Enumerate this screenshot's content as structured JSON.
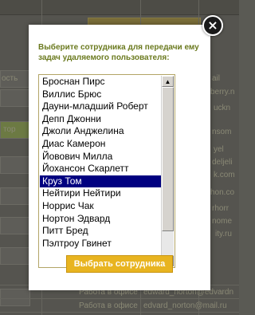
{
  "background": {
    "left_labels": [
      "ость",
      "тор"
    ],
    "right_labels": [
      "ail",
      "berry.n",
      "uckn",
      "nsom",
      "yel",
      "deljeli",
      "k.com",
      "hon.co",
      "rhorr",
      "nome",
      "ity.ru"
    ],
    "bottom_rows": [
      {
        "status": "Работа в офисе",
        "email": "edward_norton@edvardn"
      },
      {
        "status": "Работа в офисе",
        "email": "edvard_norton@mail.ru"
      }
    ]
  },
  "dialog": {
    "prompt": "Выберите сотрудника для передачи ему задач удаляемого пользователя:",
    "close_label": "×",
    "select_button_label": "Выбрать сотрудника",
    "selected_index": 8,
    "employees": [
      "Броснан Пирс",
      "Виллис Брюс",
      "Дауни-младший Роберт",
      "Депп Джонни",
      "Джоли Анджелина",
      "Диас Камерон",
      "Йовович Милла",
      "Йохансон Скарлетт",
      "Круз Том",
      "Нейтири Нейтири",
      "Норрис Чак",
      "Нортон Эдвард",
      "Питт Бред",
      "Пэлтроу Гвинет"
    ]
  }
}
